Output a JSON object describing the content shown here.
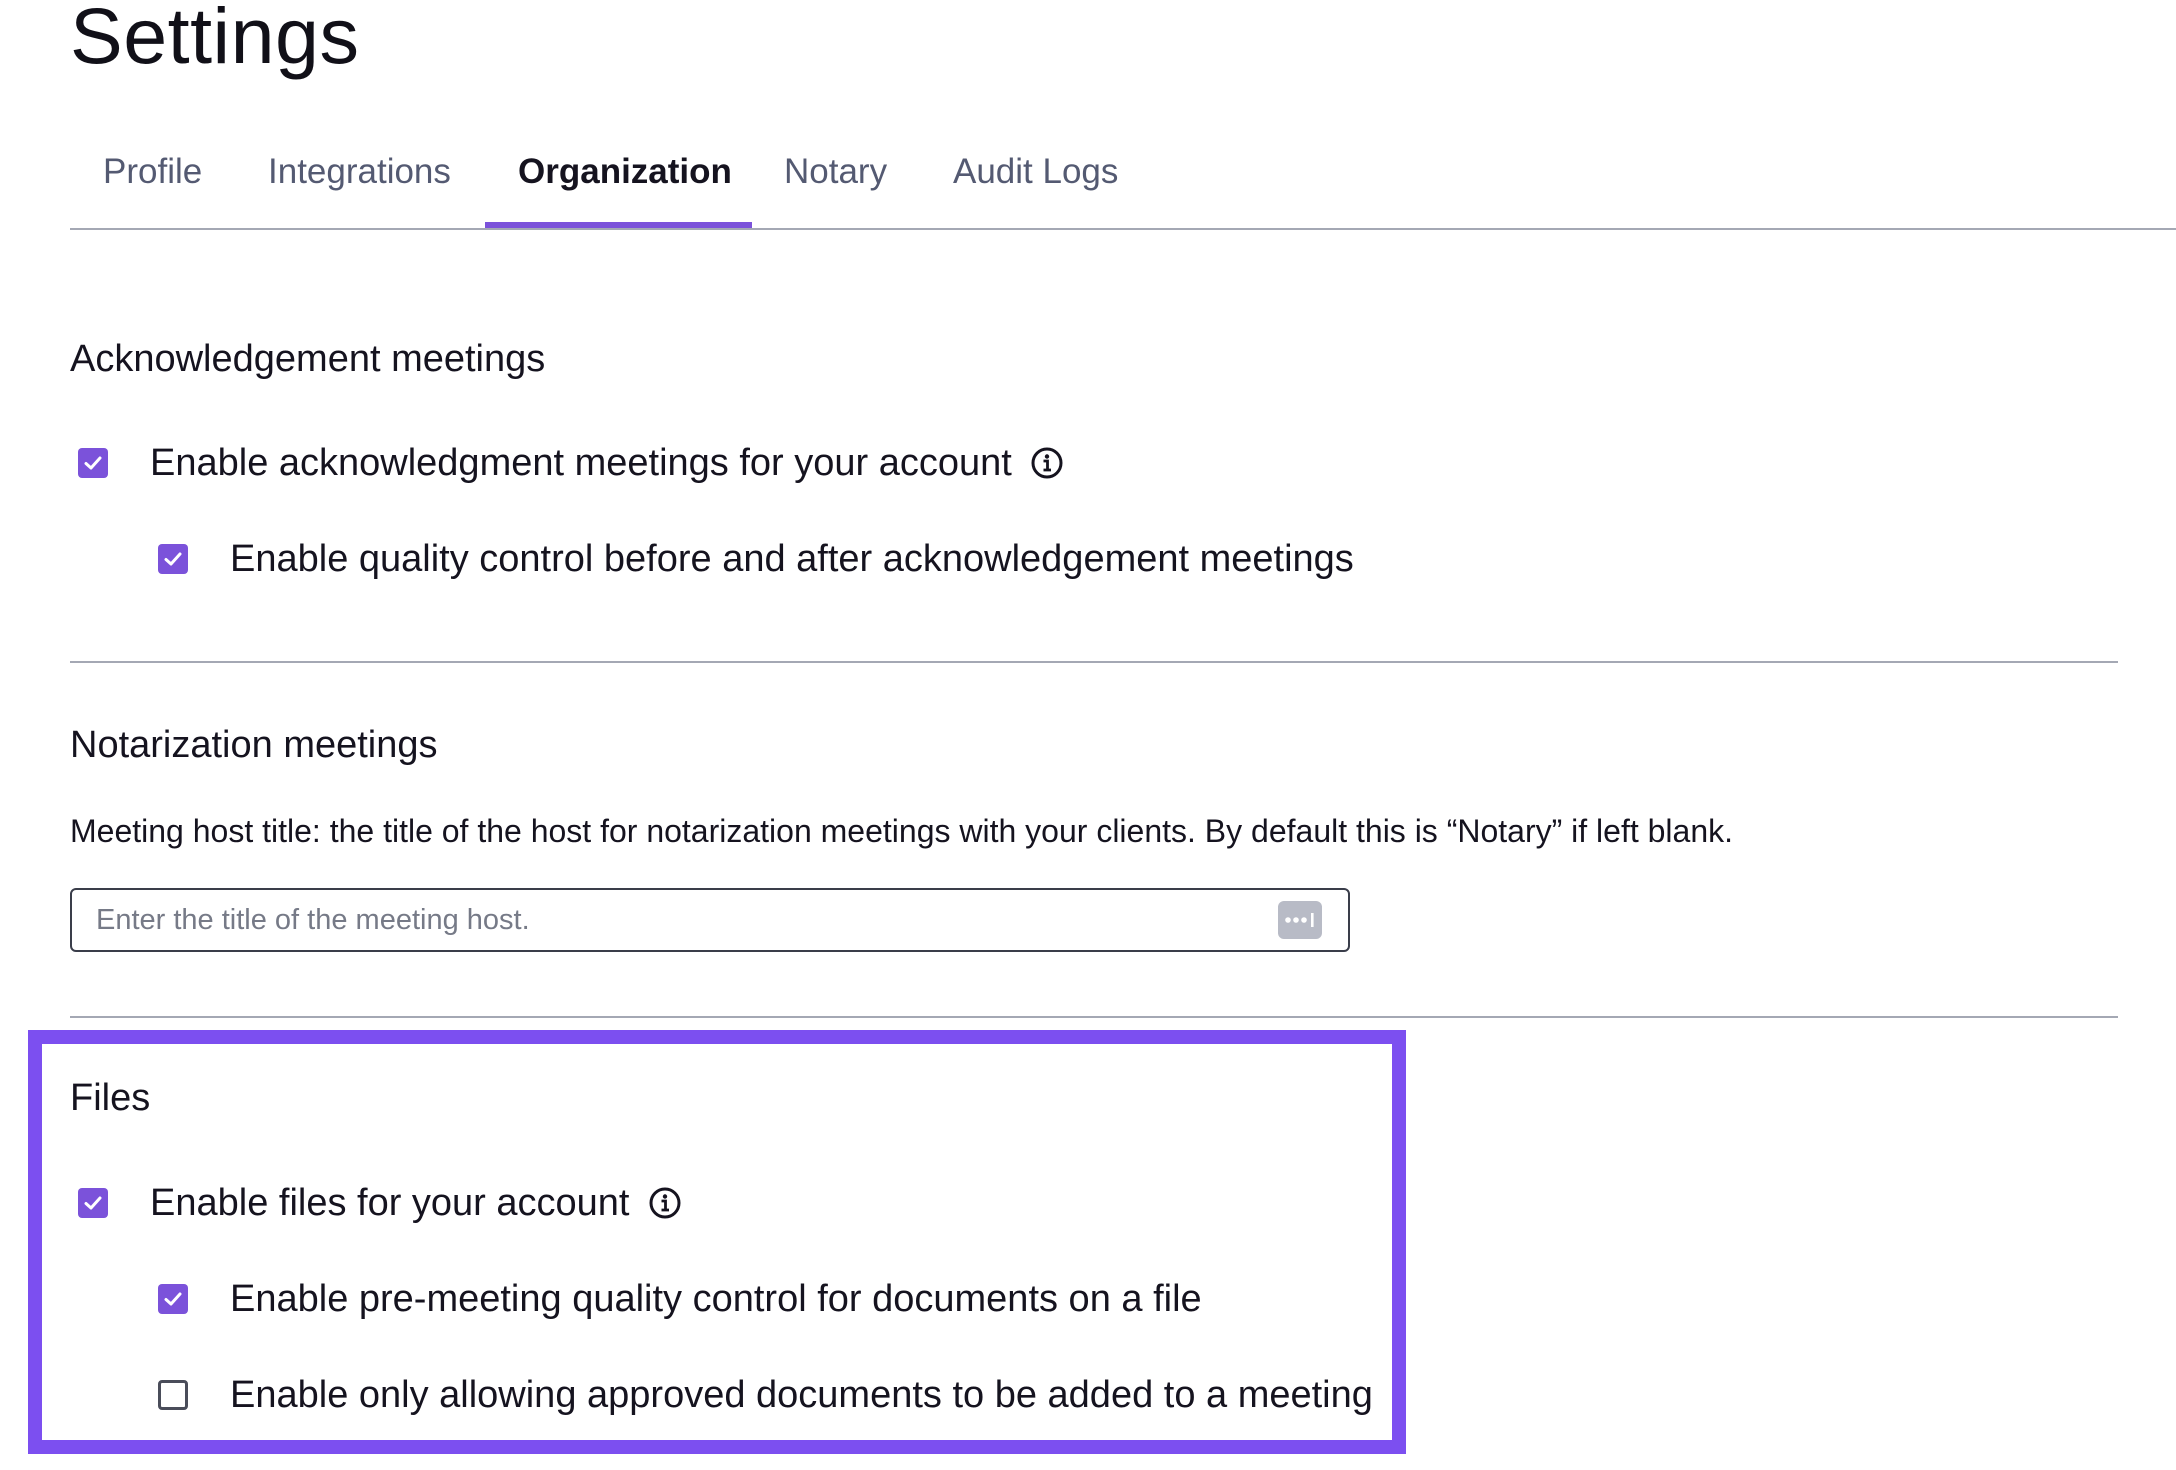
{
  "page": {
    "title": "Settings"
  },
  "tabs": [
    {
      "label": "Profile",
      "active": false
    },
    {
      "label": "Integrations",
      "active": false
    },
    {
      "label": "Organization",
      "active": true
    },
    {
      "label": "Notary",
      "active": false
    },
    {
      "label": "Audit Logs",
      "active": false
    }
  ],
  "acknowledgement": {
    "title": "Acknowledgement meetings",
    "enable_meetings": {
      "label": "Enable acknowledgment meetings for your account",
      "checked": true,
      "icon": "info-icon"
    },
    "quality_control": {
      "label": "Enable quality control before and after acknowledgement meetings",
      "checked": true
    }
  },
  "notarization": {
    "title": "Notarization meetings",
    "description": "Meeting host title: the title of the host for notarization meetings with your clients. By default this is “Notary” if left blank.",
    "host_title_input": {
      "value": "",
      "placeholder": "Enter the title of the meeting host.",
      "action_icon": "password-manager-icon"
    }
  },
  "files": {
    "title": "Files",
    "highlighted": true,
    "enable_files": {
      "label": "Enable files for your account",
      "checked": true,
      "icon": "info-icon"
    },
    "pre_meeting_qc": {
      "label": "Enable pre-meeting quality control for documents on a file",
      "checked": true
    },
    "approved_only": {
      "label": "Enable only allowing approved documents to be added to a meeting",
      "checked": false
    }
  },
  "colors": {
    "accent": "#7b52da",
    "highlight": "#7c4ff0",
    "divider": "#a4a8b4",
    "tab_inactive": "#545a72"
  }
}
